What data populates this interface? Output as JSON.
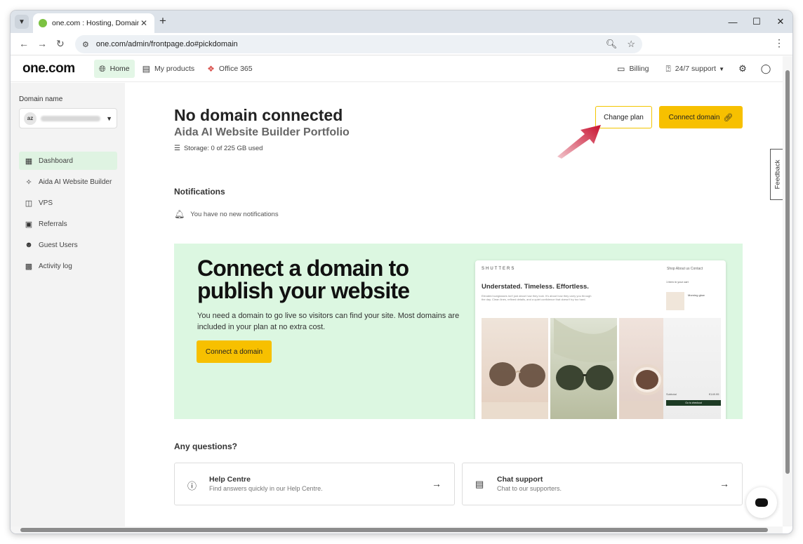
{
  "browser": {
    "tab_title": "one.com : Hosting, Domain, Em",
    "tab_close": "✕",
    "new_tab": "+",
    "url": "one.com/admin/frontpage.do#pickdomain",
    "controls": {
      "minimize": "—",
      "maximize": "☐",
      "close": "✕"
    }
  },
  "header": {
    "logo": "one.com",
    "nav": [
      {
        "label": "Home",
        "icon": "globe-icon",
        "active": true
      },
      {
        "label": "My products",
        "icon": "list-icon"
      },
      {
        "label": "Office 365",
        "icon": "office-icon"
      }
    ],
    "billing": "Billing",
    "support": "24/7 support"
  },
  "sidebar": {
    "domain_label": "Domain name",
    "avatar": "az",
    "items": [
      {
        "label": "Dashboard",
        "icon": "dashboard-icon",
        "active": true
      },
      {
        "label": "Aida AI Website Builder",
        "icon": "sparkle-icon"
      },
      {
        "label": "VPS",
        "icon": "database-icon"
      },
      {
        "label": "Referrals",
        "icon": "ticket-icon"
      },
      {
        "label": "Guest Users",
        "icon": "users-icon"
      },
      {
        "label": "Activity log",
        "icon": "chart-icon"
      }
    ]
  },
  "main": {
    "title": "No domain connected",
    "subtitle": "Aida AI Website Builder Portfolio",
    "storage": "Storage: 0 of 225 GB used",
    "change_plan": "Change plan",
    "connect_domain": "Connect domain",
    "notifications_title": "Notifications",
    "notifications_empty": "You have no new notifications",
    "banner": {
      "title": "Connect a domain to publish your website",
      "text": "You need a domain to go live so visitors can find your site. Most domains are included in your plan at no extra cost.",
      "button": "Connect a domain"
    },
    "preview": {
      "brand": "SHUTTERS",
      "nav": "Shop   About us   Contact",
      "heading": "Understated. Timeless. Effortless.",
      "sub": "Elevated sunglasses isn't just about how they look. It's about how they carry you through the day. Clean lines, refined details, and a quiet confidence that doesn't try too hard.",
      "cart_title": "1 item in your cart",
      "cart_item": "Morning glow",
      "subtotal": "Subtotal",
      "subtotal_value": "€149.95",
      "checkout": "Go to checkout"
    },
    "questions_title": "Any questions?",
    "cards": [
      {
        "title": "Help Centre",
        "sub": "Find answers quickly in our Help Centre."
      },
      {
        "title": "Chat support",
        "sub": "Chat to our supporters."
      }
    ],
    "feedback": "Feedback"
  },
  "colors": {
    "accent": "#f7c000",
    "active_bg": "#e3f6e6",
    "banner_bg": "#dcf7e1",
    "arrow": "#c8102e"
  }
}
